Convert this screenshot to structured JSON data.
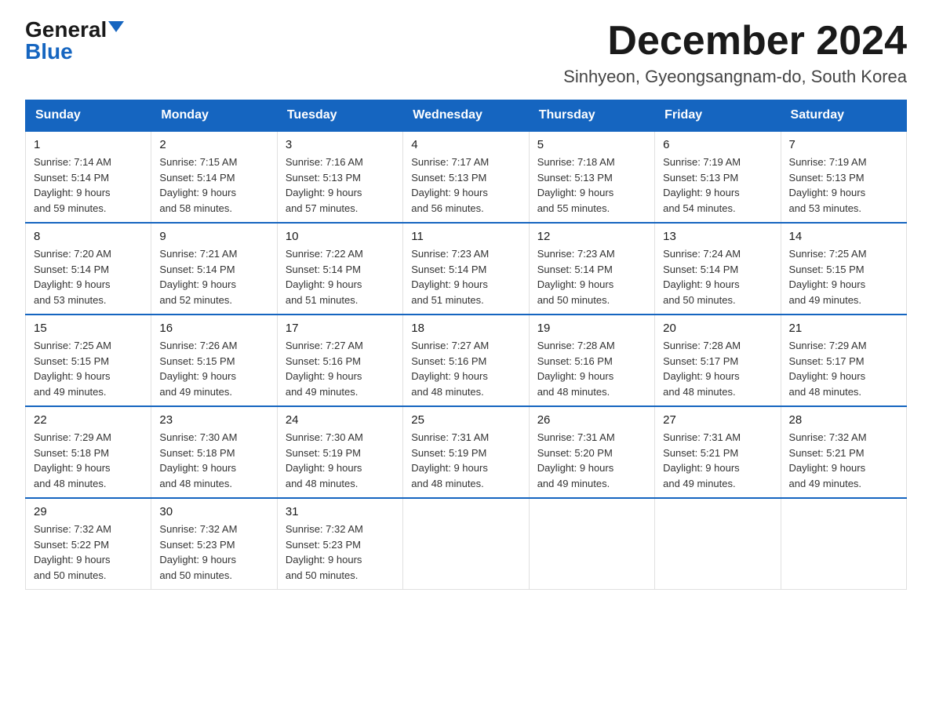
{
  "logo": {
    "general": "General",
    "blue": "Blue"
  },
  "title": {
    "month": "December 2024",
    "location": "Sinhyeon, Gyeongsangnam-do, South Korea"
  },
  "weekdays": [
    "Sunday",
    "Monday",
    "Tuesday",
    "Wednesday",
    "Thursday",
    "Friday",
    "Saturday"
  ],
  "weeks": [
    [
      {
        "day": "1",
        "sunrise": "7:14 AM",
        "sunset": "5:14 PM",
        "daylight": "9 hours and 59 minutes."
      },
      {
        "day": "2",
        "sunrise": "7:15 AM",
        "sunset": "5:14 PM",
        "daylight": "9 hours and 58 minutes."
      },
      {
        "day": "3",
        "sunrise": "7:16 AM",
        "sunset": "5:13 PM",
        "daylight": "9 hours and 57 minutes."
      },
      {
        "day": "4",
        "sunrise": "7:17 AM",
        "sunset": "5:13 PM",
        "daylight": "9 hours and 56 minutes."
      },
      {
        "day": "5",
        "sunrise": "7:18 AM",
        "sunset": "5:13 PM",
        "daylight": "9 hours and 55 minutes."
      },
      {
        "day": "6",
        "sunrise": "7:19 AM",
        "sunset": "5:13 PM",
        "daylight": "9 hours and 54 minutes."
      },
      {
        "day": "7",
        "sunrise": "7:19 AM",
        "sunset": "5:13 PM",
        "daylight": "9 hours and 53 minutes."
      }
    ],
    [
      {
        "day": "8",
        "sunrise": "7:20 AM",
        "sunset": "5:14 PM",
        "daylight": "9 hours and 53 minutes."
      },
      {
        "day": "9",
        "sunrise": "7:21 AM",
        "sunset": "5:14 PM",
        "daylight": "9 hours and 52 minutes."
      },
      {
        "day": "10",
        "sunrise": "7:22 AM",
        "sunset": "5:14 PM",
        "daylight": "9 hours and 51 minutes."
      },
      {
        "day": "11",
        "sunrise": "7:23 AM",
        "sunset": "5:14 PM",
        "daylight": "9 hours and 51 minutes."
      },
      {
        "day": "12",
        "sunrise": "7:23 AM",
        "sunset": "5:14 PM",
        "daylight": "9 hours and 50 minutes."
      },
      {
        "day": "13",
        "sunrise": "7:24 AM",
        "sunset": "5:14 PM",
        "daylight": "9 hours and 50 minutes."
      },
      {
        "day": "14",
        "sunrise": "7:25 AM",
        "sunset": "5:15 PM",
        "daylight": "9 hours and 49 minutes."
      }
    ],
    [
      {
        "day": "15",
        "sunrise": "7:25 AM",
        "sunset": "5:15 PM",
        "daylight": "9 hours and 49 minutes."
      },
      {
        "day": "16",
        "sunrise": "7:26 AM",
        "sunset": "5:15 PM",
        "daylight": "9 hours and 49 minutes."
      },
      {
        "day": "17",
        "sunrise": "7:27 AM",
        "sunset": "5:16 PM",
        "daylight": "9 hours and 49 minutes."
      },
      {
        "day": "18",
        "sunrise": "7:27 AM",
        "sunset": "5:16 PM",
        "daylight": "9 hours and 48 minutes."
      },
      {
        "day": "19",
        "sunrise": "7:28 AM",
        "sunset": "5:16 PM",
        "daylight": "9 hours and 48 minutes."
      },
      {
        "day": "20",
        "sunrise": "7:28 AM",
        "sunset": "5:17 PM",
        "daylight": "9 hours and 48 minutes."
      },
      {
        "day": "21",
        "sunrise": "7:29 AM",
        "sunset": "5:17 PM",
        "daylight": "9 hours and 48 minutes."
      }
    ],
    [
      {
        "day": "22",
        "sunrise": "7:29 AM",
        "sunset": "5:18 PM",
        "daylight": "9 hours and 48 minutes."
      },
      {
        "day": "23",
        "sunrise": "7:30 AM",
        "sunset": "5:18 PM",
        "daylight": "9 hours and 48 minutes."
      },
      {
        "day": "24",
        "sunrise": "7:30 AM",
        "sunset": "5:19 PM",
        "daylight": "9 hours and 48 minutes."
      },
      {
        "day": "25",
        "sunrise": "7:31 AM",
        "sunset": "5:19 PM",
        "daylight": "9 hours and 48 minutes."
      },
      {
        "day": "26",
        "sunrise": "7:31 AM",
        "sunset": "5:20 PM",
        "daylight": "9 hours and 49 minutes."
      },
      {
        "day": "27",
        "sunrise": "7:31 AM",
        "sunset": "5:21 PM",
        "daylight": "9 hours and 49 minutes."
      },
      {
        "day": "28",
        "sunrise": "7:32 AM",
        "sunset": "5:21 PM",
        "daylight": "9 hours and 49 minutes."
      }
    ],
    [
      {
        "day": "29",
        "sunrise": "7:32 AM",
        "sunset": "5:22 PM",
        "daylight": "9 hours and 50 minutes."
      },
      {
        "day": "30",
        "sunrise": "7:32 AM",
        "sunset": "5:23 PM",
        "daylight": "9 hours and 50 minutes."
      },
      {
        "day": "31",
        "sunrise": "7:32 AM",
        "sunset": "5:23 PM",
        "daylight": "9 hours and 50 minutes."
      },
      null,
      null,
      null,
      null
    ]
  ]
}
